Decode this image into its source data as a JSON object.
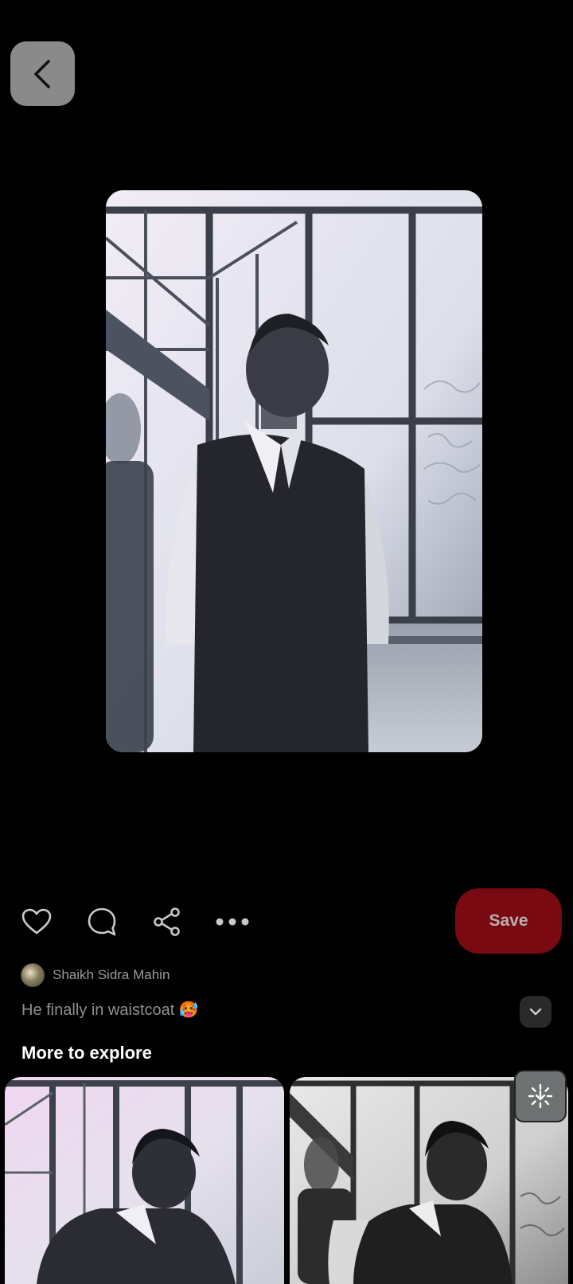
{
  "navigation": {
    "back_icon": "chevron-left-icon"
  },
  "actions": {
    "like_icon": "heart-icon",
    "comment_icon": "comment-icon",
    "share_icon": "share-icon",
    "more_icon": "more-horizontal-icon",
    "save_label": "Save"
  },
  "pin": {
    "author_name": "Shaikh Sidra Mahin",
    "description": "He finally in waistcoat 🥵",
    "expand_icon": "chevron-down-icon"
  },
  "explore": {
    "title": "More to explore",
    "visual_search_icon": "visual-search-icon"
  },
  "colors": {
    "background": "#000000",
    "save_button": "#7a0a12",
    "back_button": "#8a8a8a"
  }
}
